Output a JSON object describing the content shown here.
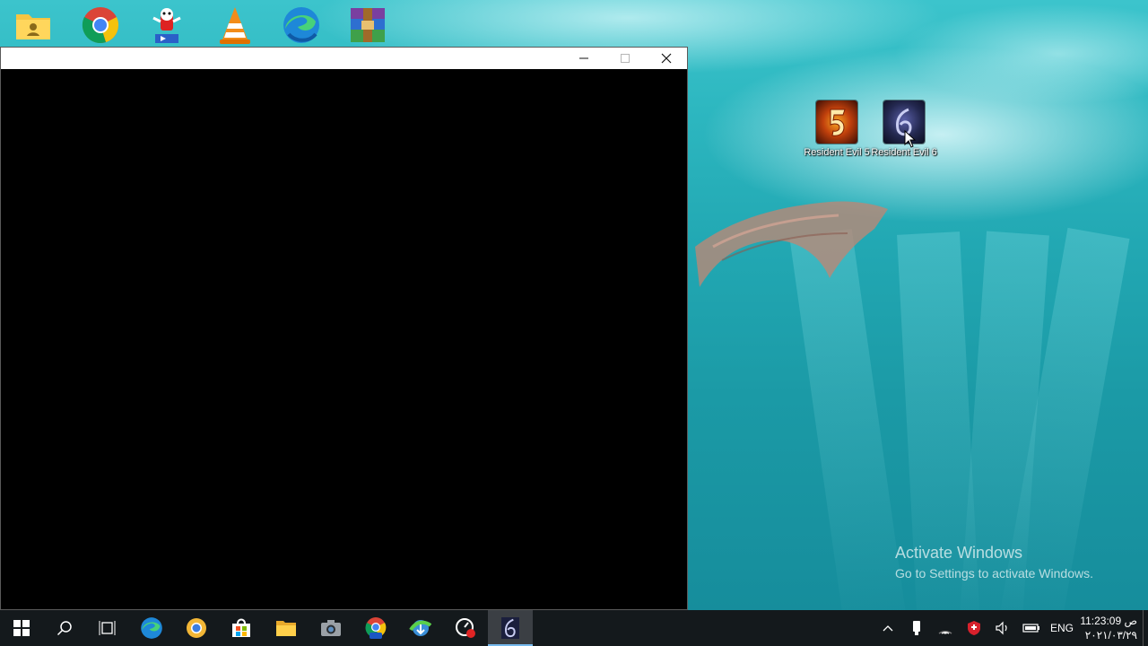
{
  "desktop": {
    "top_shortcuts": [
      {
        "name": "user-folder-icon"
      },
      {
        "name": "chrome-icon"
      },
      {
        "name": "media-mascot-icon"
      },
      {
        "name": "vlc-icon"
      },
      {
        "name": "edge-icon"
      },
      {
        "name": "winrar-icon"
      }
    ],
    "icons": [
      {
        "label": "Resident Evil 5",
        "icon": "resident-evil-5-icon"
      },
      {
        "label": "Resident Evil 6",
        "icon": "resident-evil-6-icon"
      }
    ],
    "watermark": {
      "title": "Activate Windows",
      "subtitle": "Go to Settings to activate Windows."
    }
  },
  "window": {
    "title": "",
    "controls": [
      "minimize",
      "maximize",
      "close"
    ]
  },
  "taskbar": {
    "pinned": [
      {
        "name": "start-icon"
      },
      {
        "name": "search-icon"
      },
      {
        "name": "task-view-icon"
      },
      {
        "name": "edge-icon"
      },
      {
        "name": "chrome-canary-icon"
      },
      {
        "name": "microsoft-store-icon"
      },
      {
        "name": "file-explorer-icon"
      },
      {
        "name": "camera-icon"
      },
      {
        "name": "chrome-beta-icon",
        "badge": "Beta"
      },
      {
        "name": "internet-download-manager-icon"
      },
      {
        "name": "screen-recorder-icon"
      },
      {
        "name": "resident-evil-6-icon",
        "active": true
      }
    ],
    "tray": {
      "language": "ENG",
      "time": "11:23:09 ص",
      "date": "٢٠٢١/٠٣/٢٩"
    }
  },
  "colors": {
    "taskbar_bg": "#14191c",
    "active_indicator": "#76b9ed",
    "window_content": "#000000"
  }
}
